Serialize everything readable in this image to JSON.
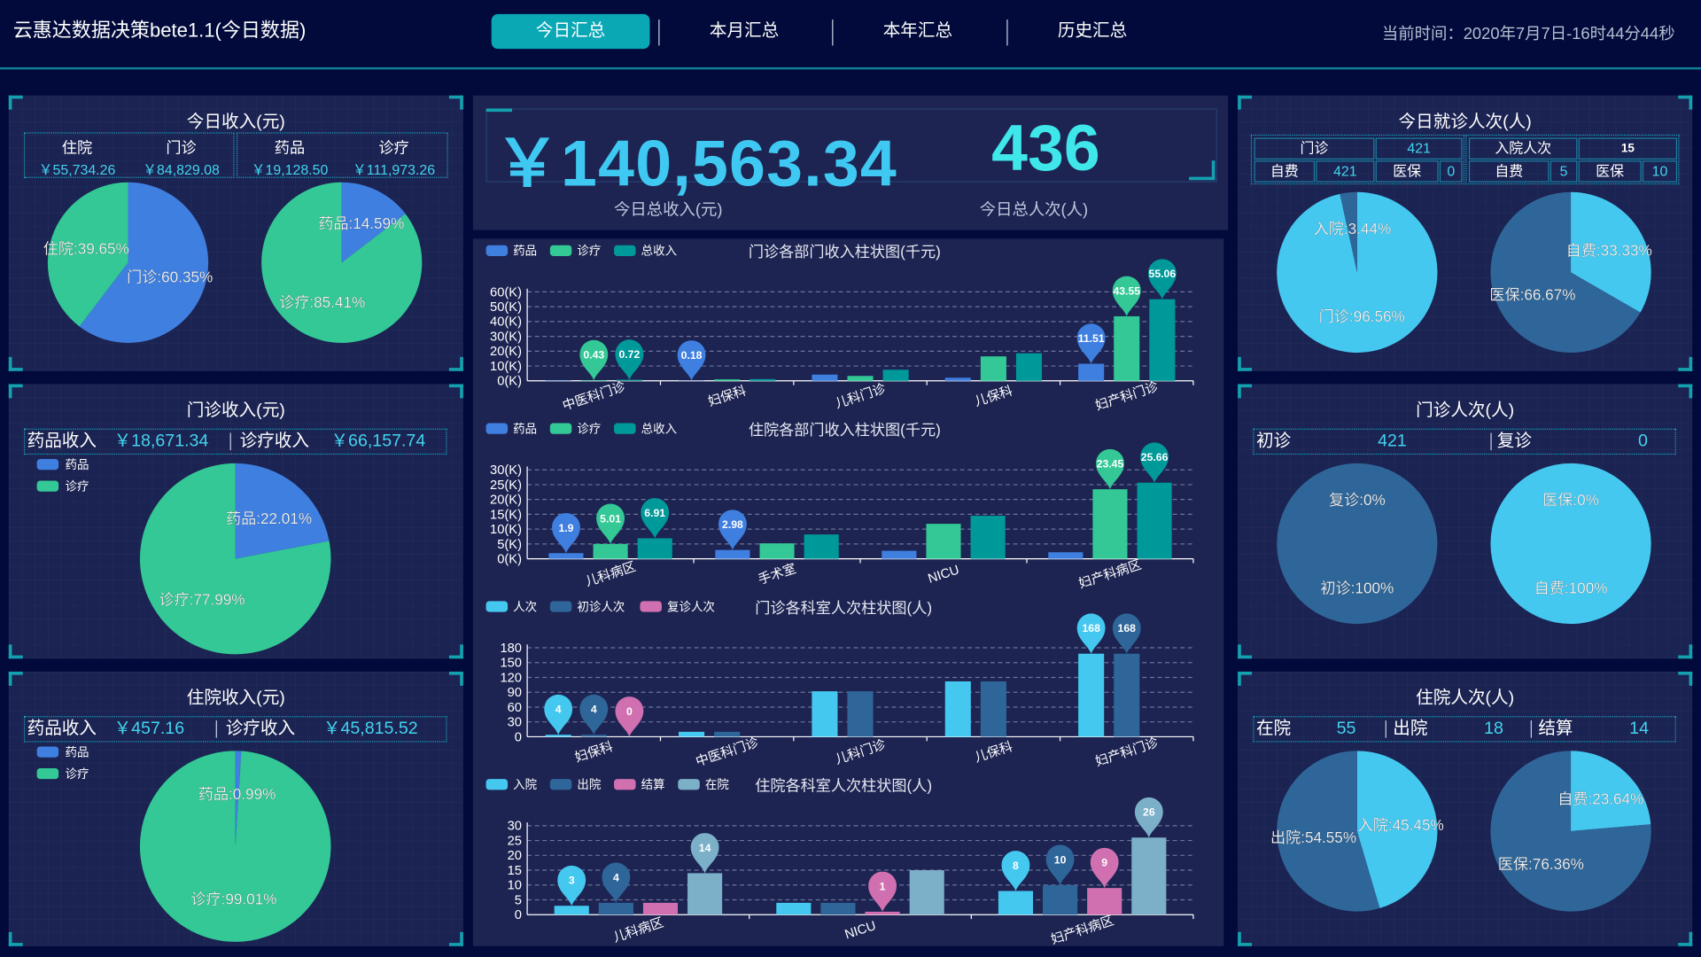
{
  "header": {
    "title": "云惠达数据决策bete1.1(今日数据)",
    "tabs": [
      "今日汇总",
      "本月汇总",
      "本年汇总",
      "历史汇总"
    ],
    "active_tab": 0,
    "time": "当前时间：2020年7月7日-16时44分44秒"
  },
  "colors": {
    "drug": "#3f7fe0",
    "treat": "#33c895",
    "total": "#00999a",
    "light": "#45c8f0",
    "dark": "#2f6699",
    "pink": "#d070b0",
    "gray": "#7bb0c8",
    "accent": "#0aa7b5"
  },
  "left": {
    "income": {
      "title": "今日收入(元)",
      "cells": [
        {
          "label": "住院",
          "value": "￥55,734.26"
        },
        {
          "label": "门诊",
          "value": "￥84,829.08"
        },
        {
          "label": "药品",
          "value": "￥19,128.50"
        },
        {
          "label": "诊疗",
          "value": "￥111,973.26"
        }
      ],
      "pies": [
        {
          "slices": [
            {
              "label": "门诊:60.35%",
              "percent": 60.35,
              "color": "#3f7fe0"
            },
            {
              "label": "住院:39.65%",
              "percent": 39.65,
              "color": "#33c895"
            }
          ]
        },
        {
          "slices": [
            {
              "label": "药品:14.59%",
              "percent": 14.59,
              "color": "#3f7fe0"
            },
            {
              "label": "诊疗:85.41%",
              "percent": 85.41,
              "color": "#33c895"
            }
          ]
        }
      ]
    },
    "outpatient_income": {
      "title": "门诊收入(元)",
      "items": [
        {
          "label": "药品收入",
          "value": "￥18,671.34"
        },
        {
          "label": "诊疗收入",
          "value": "￥66,157.74"
        }
      ],
      "legend": [
        "药品",
        "诊疗"
      ],
      "pie": {
        "slices": [
          {
            "label": "药品:22.01%",
            "percent": 22.01,
            "color": "#3f7fe0"
          },
          {
            "label": "诊疗:77.99%",
            "percent": 77.99,
            "color": "#33c895"
          }
        ]
      }
    },
    "inpatient_income": {
      "title": "住院收入(元)",
      "items": [
        {
          "label": "药品收入",
          "value": "￥457.16"
        },
        {
          "label": "诊疗收入",
          "value": "￥45,815.52"
        }
      ],
      "legend": [
        "药品",
        "诊疗"
      ],
      "pie": {
        "slices": [
          {
            "label": "药品:0.99%",
            "percent": 0.99,
            "color": "#3f7fe0"
          },
          {
            "label": "诊疗:99.01%",
            "percent": 99.01,
            "color": "#33c895"
          }
        ]
      }
    }
  },
  "center": {
    "total_income": "￥140,563.34",
    "total_income_label": "今日总收入(元)",
    "total_visits": "436",
    "total_visits_label": "今日总人次(人)"
  },
  "chart_data": [
    {
      "type": "bar",
      "title": "门诊各部门收入柱状图(千元)",
      "categories": [
        "中医科门诊",
        "妇保科",
        "儿科门诊",
        "儿保科",
        "妇产科门诊"
      ],
      "ylim": [
        0,
        60
      ],
      "yticks": [
        "0(K)",
        "10(K)",
        "20(K)",
        "30(K)",
        "40(K)",
        "50(K)",
        "60(K)"
      ],
      "grid": true,
      "legend": "top-left",
      "series": [
        {
          "name": "药品",
          "color": "#3f7fe0",
          "values": [
            0.29,
            0.18,
            4.2,
            2.1,
            11.51
          ]
        },
        {
          "name": "诊疗",
          "color": "#33c895",
          "values": [
            0.43,
            1.0,
            3.3,
            16.5,
            43.55
          ]
        },
        {
          "name": "总收入",
          "color": "#00999a",
          "values": [
            0.72,
            1.18,
            7.5,
            18.6,
            55.06
          ]
        }
      ]
    },
    {
      "type": "bar",
      "title": "住院各部门收入柱状图(千元)",
      "categories": [
        "儿科病区",
        "手术室",
        "NICU",
        "妇产科病区"
      ],
      "ylim": [
        0,
        30
      ],
      "yticks": [
        "0(K)",
        "5(K)",
        "10(K)",
        "15(K)",
        "20(K)",
        "25(K)",
        "30(K)"
      ],
      "grid": true,
      "legend": "top-left",
      "series": [
        {
          "name": "药品",
          "color": "#3f7fe0",
          "values": [
            1.9,
            2.98,
            2.7,
            2.2
          ]
        },
        {
          "name": "诊疗",
          "color": "#33c895",
          "values": [
            5.01,
            5.2,
            11.8,
            23.45
          ]
        },
        {
          "name": "总收入",
          "color": "#00999a",
          "values": [
            6.91,
            8.2,
            14.5,
            25.66
          ]
        }
      ]
    },
    {
      "type": "bar",
      "title": "门诊各科室人次柱状图(人)",
      "categories": [
        "妇保科",
        "中医科门诊",
        "儿科门诊",
        "儿保科",
        "妇产科门诊"
      ],
      "ylim": [
        0,
        180
      ],
      "yticks": [
        "0",
        "30",
        "60",
        "90",
        "120",
        "150",
        "180"
      ],
      "grid": true,
      "legend": "top-left",
      "series": [
        {
          "name": "人次",
          "color": "#45c8f0",
          "values": [
            4,
            10,
            92,
            112,
            168
          ]
        },
        {
          "name": "初诊人次",
          "color": "#2f6699",
          "values": [
            4,
            10,
            92,
            112,
            168
          ]
        },
        {
          "name": "复诊人次",
          "color": "#d070b0",
          "values": [
            0,
            0,
            0,
            0,
            0
          ]
        }
      ]
    },
    {
      "type": "bar",
      "title": "住院各科室人次柱状图(人)",
      "categories": [
        "儿科病区",
        "NICU",
        "妇产科病区"
      ],
      "ylim": [
        0,
        30
      ],
      "yticks": [
        "0",
        "5",
        "10",
        "15",
        "20",
        "25",
        "30"
      ],
      "grid": true,
      "legend": "top-left",
      "series": [
        {
          "name": "入院",
          "color": "#45c8f0",
          "values": [
            3,
            4,
            8
          ]
        },
        {
          "name": "出院",
          "color": "#2f6699",
          "values": [
            4,
            4,
            10
          ]
        },
        {
          "name": "结算",
          "color": "#d070b0",
          "values": [
            4,
            1,
            9
          ]
        },
        {
          "name": "在院",
          "color": "#7bb0c8",
          "values": [
            14,
            15,
            26
          ]
        }
      ]
    }
  ],
  "right": {
    "visits": {
      "title": "今日就诊人次(人)",
      "outpatient": {
        "label": "门诊",
        "value": "421",
        "self_label": "自费",
        "self_value": "421",
        "ins_label": "医保",
        "ins_value": "0"
      },
      "inpatient": {
        "label": "入院人次",
        "value": "15",
        "self_label": "自费",
        "self_value": "5",
        "ins_label": "医保",
        "ins_value": "10"
      },
      "pies": [
        {
          "slices": [
            {
              "label": "门诊:96.56%",
              "percent": 96.56,
              "color": "#45c8f0"
            },
            {
              "label": "入院:3.44%",
              "percent": 3.44,
              "color": "#2f6699"
            }
          ]
        },
        {
          "slices": [
            {
              "label": "自费:33.33%",
              "percent": 33.33,
              "color": "#45c8f0"
            },
            {
              "label": "医保:66.67%",
              "percent": 66.67,
              "color": "#2f6699"
            }
          ]
        }
      ]
    },
    "outpatient_visits": {
      "title": "门诊人次(人)",
      "items": [
        {
          "label": "初诊",
          "value": "421"
        },
        {
          "label": "复诊",
          "value": "0"
        }
      ],
      "pies": [
        {
          "slices": [
            {
              "label": "复诊:0%",
              "percent": 0,
              "color": "#45c8f0"
            },
            {
              "label": "初诊:100%",
              "percent": 100,
              "color": "#2f6699"
            }
          ]
        },
        {
          "slices": [
            {
              "label": "医保:0%",
              "percent": 0,
              "color": "#2f6699"
            },
            {
              "label": "自费:100%",
              "percent": 100,
              "color": "#45c8f0"
            }
          ]
        }
      ]
    },
    "inpatient_visits": {
      "title": "住院人次(人)",
      "items": [
        {
          "label": "在院",
          "value": "55"
        },
        {
          "label": "出院",
          "value": "18"
        },
        {
          "label": "结算",
          "value": "14"
        }
      ],
      "pies": [
        {
          "slices": [
            {
              "label": "入院:45.45%",
              "percent": 45.45,
              "color": "#45c8f0"
            },
            {
              "label": "出院:54.55%",
              "percent": 54.55,
              "color": "#2f6699"
            }
          ]
        },
        {
          "slices": [
            {
              "label": "自费:23.64%",
              "percent": 23.64,
              "color": "#45c8f0"
            },
            {
              "label": "医保:76.36%",
              "percent": 76.36,
              "color": "#2f6699"
            }
          ]
        }
      ]
    }
  }
}
